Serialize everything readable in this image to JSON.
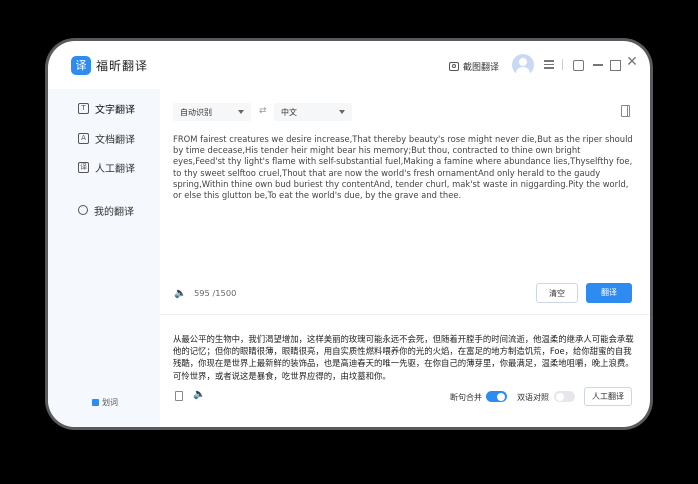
{
  "app": {
    "logo_glyph": "译",
    "name": "福昕翻译"
  },
  "titlebar": {
    "screenshot_label": "截图翻译"
  },
  "sidebar": {
    "items": [
      {
        "label": "文字翻译",
        "icon": "text-icon",
        "glyph": "T"
      },
      {
        "label": "文档翻译",
        "icon": "document-icon",
        "glyph": "A"
      },
      {
        "label": "人工翻译",
        "icon": "human-translation-icon",
        "glyph": "译"
      },
      {
        "label": "我的翻译",
        "icon": "user-icon",
        "glyph": ""
      }
    ],
    "bottom_option": "划词"
  },
  "translator": {
    "source_lang": "自动识别",
    "target_lang": "中文",
    "swap_glyph": "⇄",
    "source_text": "FROM fairest creatures we desire increase,That thereby beauty's rose might never die,But as the riper should by time decease,His tender heir might bear his memory;But thou, contracted to thine own bright eyes,Feed'st thy light's flame with self-substantial fuel,Making a famine where abundance lies,Thyselfthy foe, to thy sweet selftoo cruel,Thout that are now the world's fresh ornamentAnd only herald to the gaudy spring,Within thine own bud buriest thy contentAnd, tender churl, mak'st waste in niggarding.Pity the world, or else this glutton be,To eat the world's due, by the grave and thee.",
    "char_count": "595 /1500",
    "clear_label": "清空",
    "translate_label": "翻译",
    "result_text": "从最公平的生物中，我们渴望增加，这样美丽的玫瑰可能永远不会死，但随着开膛手的时间流逝，他温柔的继承人可能会承载他的记忆；但你的眼睛很薄，眼睛很亮，用自实质性燃料喂养你的光的火焰，在富足的地方制造饥荒，Foe，给你甜蜜的自我残酷，你现在是世界上最新鲜的装饰品，也是高迪春天的唯一先驱，在你自己的薄芽里，你最满足，温柔地咀嚼，晚上浪费。可怜世界，或者说这是暴食，吃世界应得的，由坟墓和你。",
    "merge_label": "断句合并",
    "merge_on": true,
    "bilingual_label": "双语对照",
    "bilingual_on": false,
    "human_translate_label": "人工翻译"
  },
  "colors": {
    "accent": "#2e8cf0",
    "sidebar_bg": "#f5f8fd"
  }
}
